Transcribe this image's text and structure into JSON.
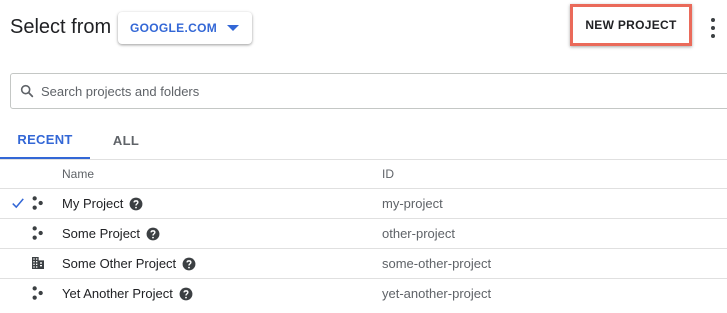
{
  "header": {
    "title": "Select from",
    "organization": "GOOGLE.COM",
    "new_project_label": "NEW PROJECT"
  },
  "search": {
    "placeholder": "Search projects and folders",
    "value": ""
  },
  "tabs": [
    {
      "label": "RECENT",
      "active": true
    },
    {
      "label": "ALL",
      "active": false
    }
  ],
  "table": {
    "columns": [
      "Name",
      "ID"
    ],
    "rows": [
      {
        "name": "My Project",
        "id": "my-project",
        "type_icon": "project-icon",
        "selected": true
      },
      {
        "name": "Some Project",
        "id": "other-project",
        "type_icon": "project-icon",
        "selected": false
      },
      {
        "name": "Some Other Project",
        "id": "some-other-project",
        "type_icon": "organization-building-icon",
        "selected": false
      },
      {
        "name": "Yet Another Project",
        "id": "yet-another-project",
        "type_icon": "project-icon",
        "selected": false
      }
    ]
  },
  "colors": {
    "accent": "#3367d6",
    "highlight": "#ea6a5a",
    "divider": "#e0e0e0"
  }
}
